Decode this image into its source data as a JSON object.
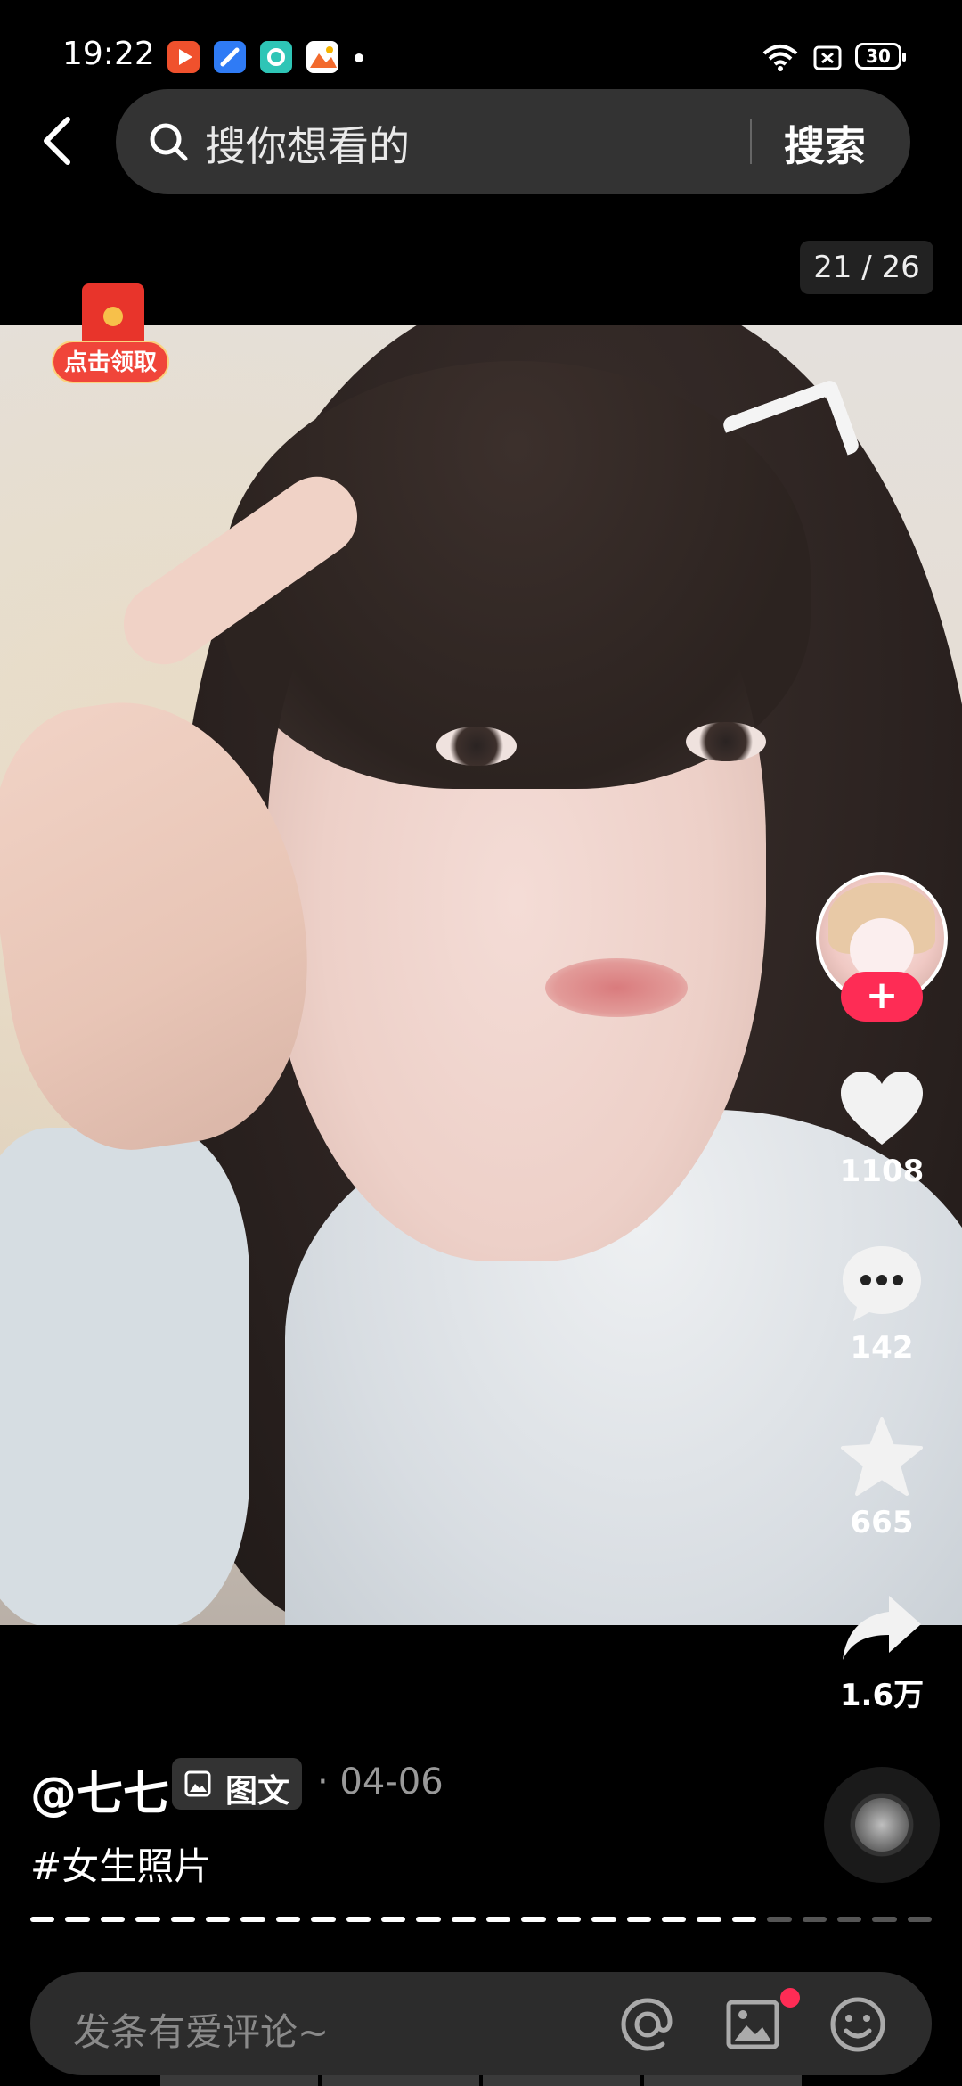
{
  "status_bar": {
    "time": "19:22",
    "battery": "30",
    "app_icons": [
      "video-app-icon",
      "blue-app-icon",
      "teal-app-icon",
      "photo-app-icon"
    ]
  },
  "search": {
    "placeholder": "搜你想看的",
    "button_label": "搜索"
  },
  "image_counter": "21 / 26",
  "red_packet": {
    "label": "点击领取"
  },
  "actions": {
    "follow_symbol": "+",
    "likes": "1108",
    "comments": "142",
    "favorites": "665",
    "shares": "1.6万"
  },
  "post": {
    "author": "@七七",
    "type_label": "图文",
    "date": "· 04-06",
    "hashtag": "#女生照片",
    "progress": {
      "total": 26,
      "current": 21
    }
  },
  "comment_bar": {
    "placeholder": "发条有爱评论~"
  },
  "colors": {
    "accent": "#fe2c55",
    "background": "#000000",
    "search_bg": "#333333"
  }
}
